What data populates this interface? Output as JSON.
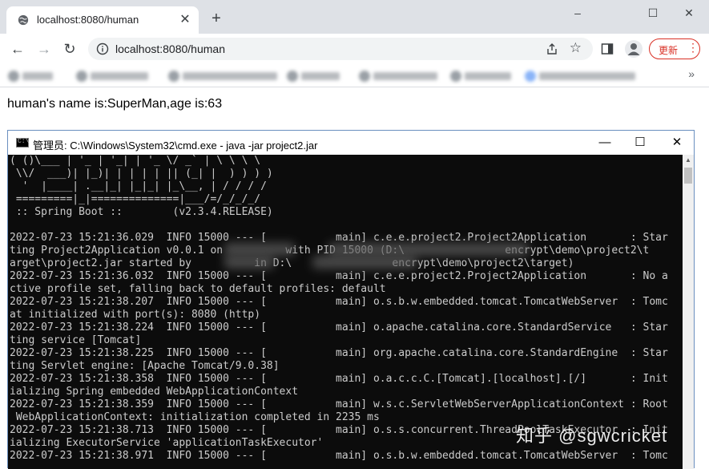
{
  "browser": {
    "tab_title": "localhost:8080/human",
    "new_tab_label": "+",
    "tab_close_label": "✕",
    "window_controls": {
      "minimize": "–",
      "maximize": "☐",
      "close": "✕"
    },
    "url": "localhost:8080/human",
    "back_label": "←",
    "forward_label": "→",
    "reload_label": "↻",
    "update_button_label": "更新",
    "menu_label": "⋮",
    "bookmarks_more_label": "»"
  },
  "page": {
    "body_text": "human's name is:SuperMan,age is:63"
  },
  "cmd_window": {
    "title": "管理员: C:\\Windows\\System32\\cmd.exe - java  -jar project2.jar",
    "icon_text": "C:\\",
    "controls": {
      "minimize": "—",
      "maximize": "☐",
      "close": "✕"
    }
  },
  "console": {
    "text": "( ()\\___ | '_ | '_| | '_ \\/ _` | \\ \\ \\ \\\n \\\\/  ___)| |_)| | | | | || (_| |  ) ) ) )\n  '  |____| .__|_| |_|_| |_\\__, | / / / /\n =========|_|==============|___/=/_/_/_/\n :: Spring Boot ::        (v2.3.4.RELEASE)\n\n2022-07-23 15:21:36.029  INFO 15000 --- [           main] c.e.e.project2.Project2Application       : Star\nting Project2Application v0.0.1 on          with PID 15000 (D:\\                encrypt\\demo\\project2\\t\narget\\project2.jar started by          in D:\\                encrypt\\demo\\project2\\target)\n2022-07-23 15:21:36.032  INFO 15000 --- [           main] c.e.e.project2.Project2Application       : No a\nctive profile set, falling back to default profiles: default\n2022-07-23 15:21:38.207  INFO 15000 --- [           main] o.s.b.w.embedded.tomcat.TomcatWebServer  : Tomc\nat initialized with port(s): 8080 (http)\n2022-07-23 15:21:38.224  INFO 15000 --- [           main] o.apache.catalina.core.StandardService   : Star\nting service [Tomcat]\n2022-07-23 15:21:38.225  INFO 15000 --- [           main] org.apache.catalina.core.StandardEngine  : Star\nting Servlet engine: [Apache Tomcat/9.0.38]\n2022-07-23 15:21:38.358  INFO 15000 --- [           main] o.a.c.c.C.[Tomcat].[localhost].[/]       : Init\nializing Spring embedded WebApplicationContext\n2022-07-23 15:21:38.359  INFO 15000 --- [           main] w.s.c.ServletWebServerApplicationContext : Root\n WebApplicationContext: initialization completed in 2235 ms\n2022-07-23 15:21:38.713  INFO 15000 --- [           main] o.s.s.concurrent.ThreadPoolTaskExecutor  : Init\nializing ExecutorService 'applicationTaskExecutor'\n2022-07-23 15:21:38.971  INFO 15000 --- [           main] o.s.b.w.embedded.tomcat.TomcatWebServer  : Tomc"
  },
  "watermark": "知乎 @sgwcricket",
  "colors": {
    "tabstrip_bg": "#dee1e6",
    "console_bg": "#0c0c0c",
    "console_fg": "#cccccc",
    "update_accent": "#d93025"
  }
}
